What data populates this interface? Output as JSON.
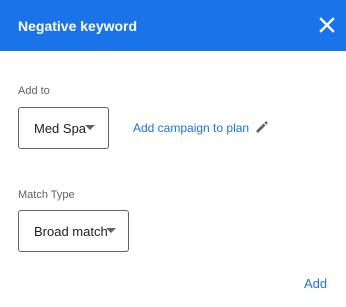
{
  "dialog": {
    "title": "Negative keyword",
    "close_icon": "close-icon",
    "header_color": "#1a73e8"
  },
  "add_to": {
    "label": "Add to",
    "selected": "Med Spa",
    "arrow_icon": "arrow-drop-down-icon",
    "add_campaign_link": "Add campaign to plan",
    "edit_icon": "pencil-icon"
  },
  "match_type": {
    "label": "Match Type",
    "selected": "Broad match",
    "arrow_icon": "arrow-drop-down-icon"
  },
  "actions": {
    "add_label": "Add",
    "accent_color": "#1a73e8"
  }
}
